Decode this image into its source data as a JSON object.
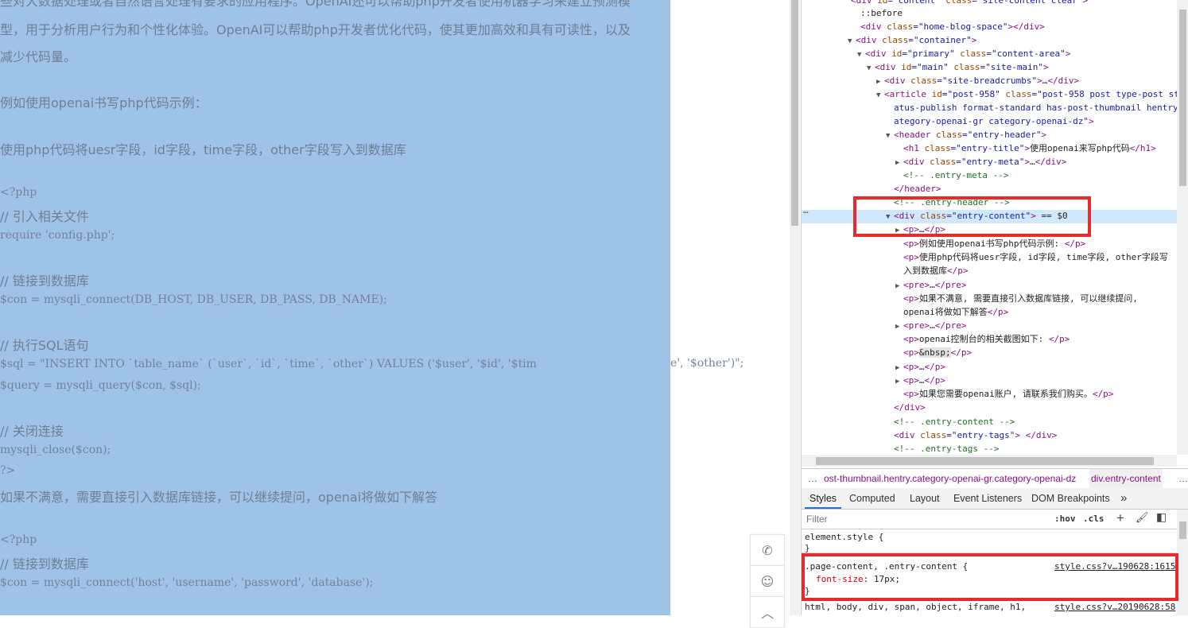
{
  "page": {
    "lines": [
      "型，用于分析用户行为和个性化体验。OpenAI可以帮助php开发者优化代码，使其更加高效和具有可读性，以及",
      "减少代码量。",
      "例如使用openai书写php代码示例：",
      "使用php代码将uesr字段，id字段，time字段，other字段写入到数据库",
      "<?php",
      "// 引入相关文件",
      "require 'config.php';",
      "// 链接到数据库",
      "$con = mysqli_connect(DB_HOST, DB_USER, DB_PASS, DB_NAME);",
      "// 执行SQL语句",
      "$sql = \"INSERT INTO `table_name` (`user`, `id`, `time`, `other`) VALUES ('$user', '$id', '$tim",
      "$query = mysqli_query($con, $sql);",
      "// 关闭连接",
      "mysqli_close($con);",
      "?>",
      "如果不满意，需要直接引入数据库链接，可以继续提问，openai将做如下解答",
      "<?php",
      "// 链接到数据库",
      "$con = mysqli_connect('host', 'username', 'password', 'database');"
    ],
    "code_overflow": "e', '$other')\";"
  },
  "side_buttons": {
    "phone": "✆",
    "wechat": "☺",
    "up": "︿"
  },
  "elements": {
    "rows": [
      {
        "html": "<span class='tag'>&lt;div </span><span class='an'>id</span>=<span class='av'>\"content\"</span> <span class='an'>class</span>=<span class='av'>\"site-content clear\"</span><span class='tag'>&gt;</span>"
      },
      {
        "html": "<span class='txt'>::before</span>"
      },
      {
        "html": "<span class='tag'>&lt;div </span><span class='an'>class</span>=<span class='av'>\"home-blog-space\"</span><span class='tag'>&gt;&lt;/div&gt;</span>"
      },
      {
        "html": "<span class='tag'>&lt;div </span><span class='an'>class</span>=<span class='av'>\"container\"</span><span class='tag'>&gt;</span>"
      },
      {
        "html": "<span class='tag'>&lt;div </span><span class='an'>id</span>=<span class='av'>\"primary\"</span> <span class='an'>class</span>=<span class='av'>\"content-area\"</span><span class='tag'>&gt;</span>"
      },
      {
        "html": "<span class='tag'>&lt;div </span><span class='an'>id</span>=<span class='av'>\"main\"</span> <span class='an'>class</span>=<span class='av'>\"site-main\"</span><span class='tag'>&gt;</span>"
      },
      {
        "html": "<span class='tag'>&lt;div </span><span class='an'>class</span>=<span class='av'>\"site-breadcrumbs\"</span><span class='tag'>&gt;</span><span class='txt'>…</span><span class='tag'>&lt;/div&gt;</span>"
      },
      {
        "html": "<span class='tag'>&lt;article </span><span class='an'>id</span>=<span class='av'>\"post-958\"</span> <span class='an'>class</span>=<span class='av'>\"post-958 post type-post st</span>"
      },
      {
        "html": "<span class='av'>atus-publish format-standard has-post-thumbnail hentry c</span>"
      },
      {
        "html": "<span class='av'>ategory-openai-gr category-openai-dz\"</span><span class='tag'>&gt;</span>"
      },
      {
        "html": "<span class='tag'>&lt;header </span><span class='an'>class</span>=<span class='av'>\"entry-header\"</span><span class='tag'>&gt;</span>"
      },
      {
        "html": "<span class='tag'>&lt;h1 </span><span class='an'>class</span>=<span class='av'>\"entry-title\"</span><span class='tag'>&gt;</span><span class='txt'>使用openai来写php代码</span><span class='tag'>&lt;/h1&gt;</span>"
      },
      {
        "html": "<span class='tag'>&lt;div </span><span class='an'>class</span>=<span class='av'>\"entry-meta\"</span><span class='tag'>&gt;</span><span class='txt'>…</span><span class='tag'>&lt;/div&gt;</span>"
      },
      {
        "html": "<span class='cmt'>&lt;!-- .entry-meta --&gt;</span>"
      },
      {
        "html": "<span class='tag'>&lt;/header&gt;</span>"
      },
      {
        "html": "<span class='cmt'>&lt;!-- .entry-header --&gt;</span>"
      },
      {
        "html": "<span class='tag'>&lt;div </span><span class='an'>class</span>=<span class='av'>\"entry-content\"</span><span class='tag'>&gt;</span> <span class='txt'>== $0</span>"
      },
      {
        "html": "<span class='tag'>&lt;p&gt;</span><span class='txt'>…</span><span class='tag'>&lt;/p&gt;</span>"
      },
      {
        "html": "<span class='tag'>&lt;p&gt;</span><span class='txt'>例如使用openai书写php代码示例: </span><span class='tag'>&lt;/p&gt;</span>"
      },
      {
        "html": "<span class='tag'>&lt;p&gt;</span><span class='txt'>使用php代码将uesr字段, id字段, time字段, other字段写</span>"
      },
      {
        "html": "<span class='txt'>入到数据库</span><span class='tag'>&lt;/p&gt;</span>"
      },
      {
        "html": "<span class='tag'>&lt;pre&gt;</span><span class='txt'>…</span><span class='tag'>&lt;/pre&gt;</span>"
      },
      {
        "html": "<span class='tag'>&lt;p&gt;</span><span class='txt'>如果不满意, 需要直接引入数据库链接, 可以继续提问,</span>"
      },
      {
        "html": "<span class='txt'>openai将做如下解答</span><span class='tag'>&lt;/p&gt;</span>"
      },
      {
        "html": "<span class='tag'>&lt;pre&gt;</span><span class='txt'>…</span><span class='tag'>&lt;/pre&gt;</span>"
      },
      {
        "html": "<span class='tag'>&lt;p&gt;</span><span class='txt'>openai控制台的相关截图如下: </span><span class='tag'>&lt;/p&gt;</span>"
      },
      {
        "html": "<span class='tag'>&lt;p&gt;</span><span class='txt' style='background:#e2e2e2'>&amp;nbsp;</span><span class='tag'>&lt;/p&gt;</span>"
      },
      {
        "html": "<span class='tag'>&lt;p&gt;</span><span class='txt'>…</span><span class='tag'>&lt;/p&gt;</span>"
      },
      {
        "html": "<span class='tag'>&lt;p&gt;</span><span class='txt'>…</span><span class='tag'>&lt;/p&gt;</span>"
      },
      {
        "html": "<span class='tag'>&lt;p&gt;</span><span class='txt'>如果您需要openai账户, 请联系我们购买。</span><span class='tag'>&lt;/p&gt;</span>"
      },
      {
        "html": "<span class='tag'>&lt;/div&gt;</span>"
      },
      {
        "html": "<span class='cmt'>&lt;!-- .entry-content --&gt;</span>"
      },
      {
        "html": "<span class='tag'>&lt;div </span><span class='an'>class</span>=<span class='av'>\"entry-tags\"</span><span class='tag'>&gt; &lt;/div&gt;</span>"
      },
      {
        "html": "<span class='cmt'>&lt;!-- .entry-tags --&gt;</span>"
      }
    ],
    "selected_marker": "…"
  },
  "breadcrumbs": {
    "ellipsis": "…",
    "item1": "ost-thumbnail.hentry.category-openai-gr.category-openai-dz",
    "item2": "div.entry-content",
    "more": "…"
  },
  "tabs": [
    "Styles",
    "Computed",
    "Layout",
    "Event Listeners",
    "DOM Breakpoints",
    "»"
  ],
  "filter": {
    "placeholder": "Filter",
    "hov": ":hov",
    "cls": ".cls",
    "plus": "+",
    "paint": "🖌",
    "toggle": "◧"
  },
  "styles": {
    "element_style": "element.style {",
    "element_close": "}",
    "rule_selector": ".page-content, .entry-content {",
    "rule_source": "style.css?v…190628:1615",
    "rule_prop_name": "font-size",
    "rule_prop_value": "17px;",
    "rule_close": "}",
    "next_selector": "html, body, div, span, object, iframe, h1,",
    "next_source": "style.css?v…20190628:58"
  },
  "colors": {
    "highlight": "#e52b2b",
    "selection_bg": "#9fc3e7"
  }
}
